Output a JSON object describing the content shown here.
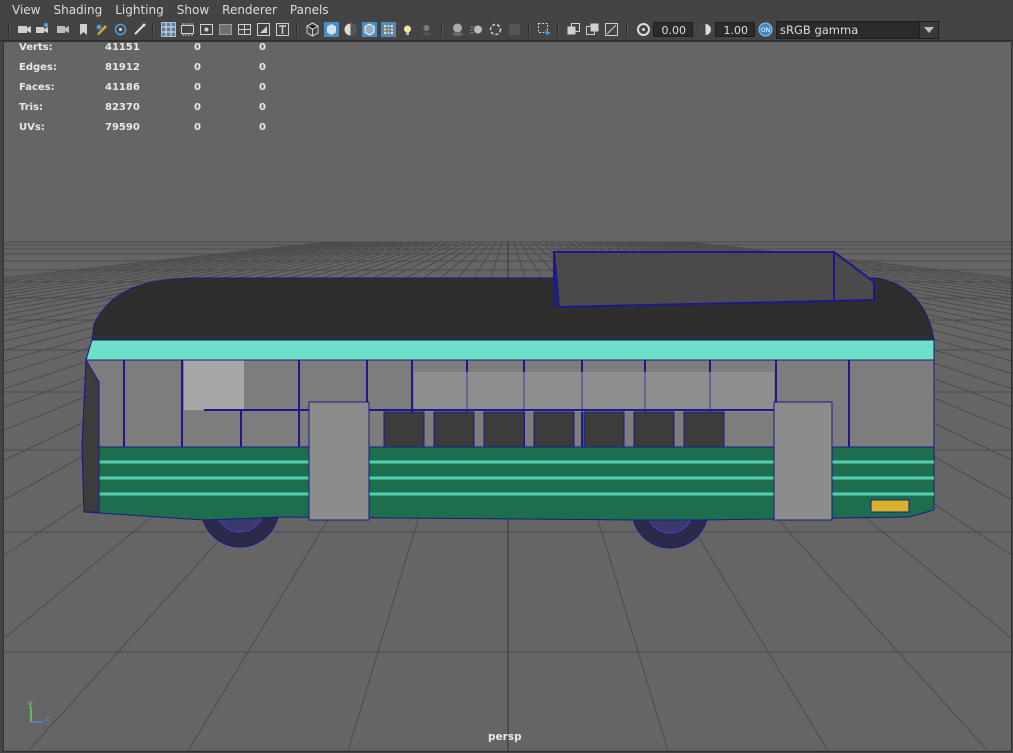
{
  "menu": [
    "View",
    "Shading",
    "Lighting",
    "Show",
    "Renderer",
    "Panels"
  ],
  "toolbar": {
    "exposure_value": "0.00",
    "gamma_value": "1.00",
    "color_space": "sRGB gamma",
    "icons": [
      "camera-select-icon",
      "camera-attributes-icon",
      "bookmarks-icon",
      "image-plane-icon",
      "grease-pencil-icon",
      "isolate-select-icon",
      "xray-icon",
      "grid-icon",
      "film-gate-icon",
      "resolution-gate-icon",
      "gate-mask-icon",
      "field-chart-icon",
      "safe-action-icon",
      "safe-title-icon",
      "wireframe-icon",
      "smooth-shade-icon",
      "default-material-icon",
      "wireframe-on-shaded-icon",
      "xray-joints-icon",
      "use-all-lights-icon",
      "shadows-icon",
      "screen-space-ao-icon",
      "motion-blur-icon",
      "multisample-aa-icon",
      "depth-of-field-icon",
      "isolate-icon",
      "xray-active-icon",
      "xray-mode-icon",
      "toggle-hud-icon",
      "exposure-icon",
      "gamma-icon",
      "view-transform-icon"
    ],
    "colors": {
      "bg": "#444444",
      "active": "#5ba3d6",
      "field": "#2b2b2b"
    }
  },
  "hud": {
    "rows": [
      {
        "label": "Verts:",
        "v1": "41151",
        "v2": "0",
        "v3": "0"
      },
      {
        "label": "Edges:",
        "v1": "81912",
        "v2": "0",
        "v3": "0"
      },
      {
        "label": "Faces:",
        "v1": "41186",
        "v2": "0",
        "v3": "0"
      },
      {
        "label": "Tris:",
        "v1": "82370",
        "v2": "0",
        "v3": "0"
      },
      {
        "label": "UVs:",
        "v1": "79590",
        "v2": "0",
        "v3": "0"
      }
    ]
  },
  "viewport": {
    "camera": "persp",
    "axis_y": "y",
    "axis_z": "z",
    "colors": {
      "background": "#656565",
      "grid": "#4a4a4a",
      "wire": "#1a1a8c",
      "bus_green": "#1b6b4a",
      "bus_teal": "#6fe0c8"
    }
  }
}
